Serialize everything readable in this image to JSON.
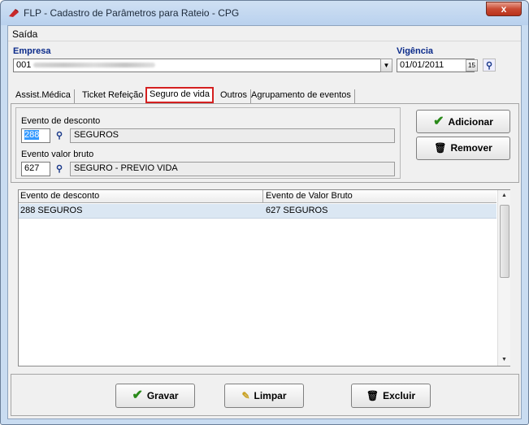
{
  "window": {
    "title": "FLP - Cadastro de Parâmetros para Rateio - CPG",
    "close_label": "x"
  },
  "menu": {
    "saida": "Saída"
  },
  "empresa": {
    "label": "Empresa",
    "value": "001"
  },
  "vigencia": {
    "label": "Vigência",
    "value": "01/01/2011",
    "calendar_label": "15"
  },
  "tabs": [
    {
      "label": "Assist.Médica"
    },
    {
      "label": "Ticket Refeição"
    },
    {
      "label": "Seguro de vida"
    },
    {
      "label": "Outros"
    },
    {
      "label": "Agrupamento de eventos"
    }
  ],
  "form": {
    "desconto_label": "Evento de desconto",
    "desconto_code": "288",
    "desconto_desc": "SEGUROS",
    "bruto_label": "Evento valor bruto",
    "bruto_code": "627",
    "bruto_desc": "SEGURO - PREVIO VIDA"
  },
  "buttons": {
    "adicionar": "Adicionar",
    "remover": "Remover",
    "gravar": "Gravar",
    "limpar": "Limpar",
    "excluir": "Excluir"
  },
  "grid": {
    "headers": [
      "Evento de desconto",
      "Evento de Valor Bruto"
    ],
    "rows": [
      {
        "c1": "288 SEGUROS",
        "c2": "627 SEGUROS"
      }
    ]
  },
  "icons": {
    "app": "app-icon",
    "check": "check-icon",
    "trash": "trash-icon",
    "binoculars": "binoculars-icon",
    "eraser": "eraser-icon"
  }
}
